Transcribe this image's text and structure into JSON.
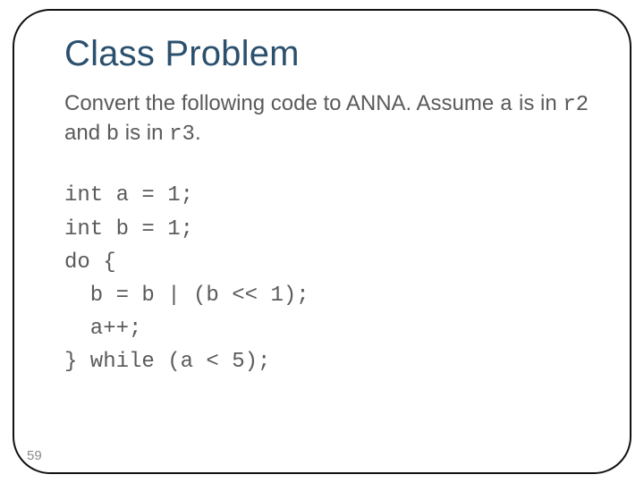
{
  "title": "Class Problem",
  "desc": {
    "p1": "Convert the following code to ANNA. Assume ",
    "a": "a",
    "p2": " is in ",
    "r2": "r2",
    "p3": " and ",
    "b": "b",
    "p4": " is in ",
    "r3": "r3",
    "p5": "."
  },
  "code": {
    "l1": "int a = 1;",
    "l2": "int b = 1;",
    "l3": "do {",
    "l4": "  b = b | (b << 1);",
    "l5": "  a++;",
    "l6": "} while (a < 5);"
  },
  "page_number": "59"
}
